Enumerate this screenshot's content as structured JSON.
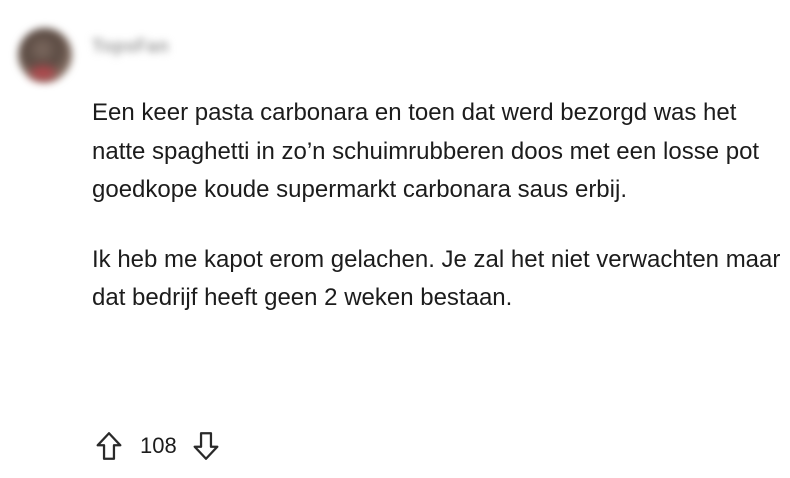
{
  "comment": {
    "username": "TopsFan",
    "paragraphs": [
      "Een keer pasta carbonara en toen dat werd bezorgd was het natte spaghetti in zo’n schuimrubberen doos met een losse pot goedkope koude supermarkt carbonara saus erbij.",
      "Ik heb me kapot erom gelachen. Je zal het niet verwachten maar dat bedrijf heeft geen 2 weken bestaan."
    ],
    "vote_count": "108"
  },
  "icons": {
    "upvote": "arrow-up-outline-icon",
    "downvote": "arrow-down-outline-icon"
  },
  "colors": {
    "text": "#1c1c1c",
    "background": "#ffffff"
  }
}
